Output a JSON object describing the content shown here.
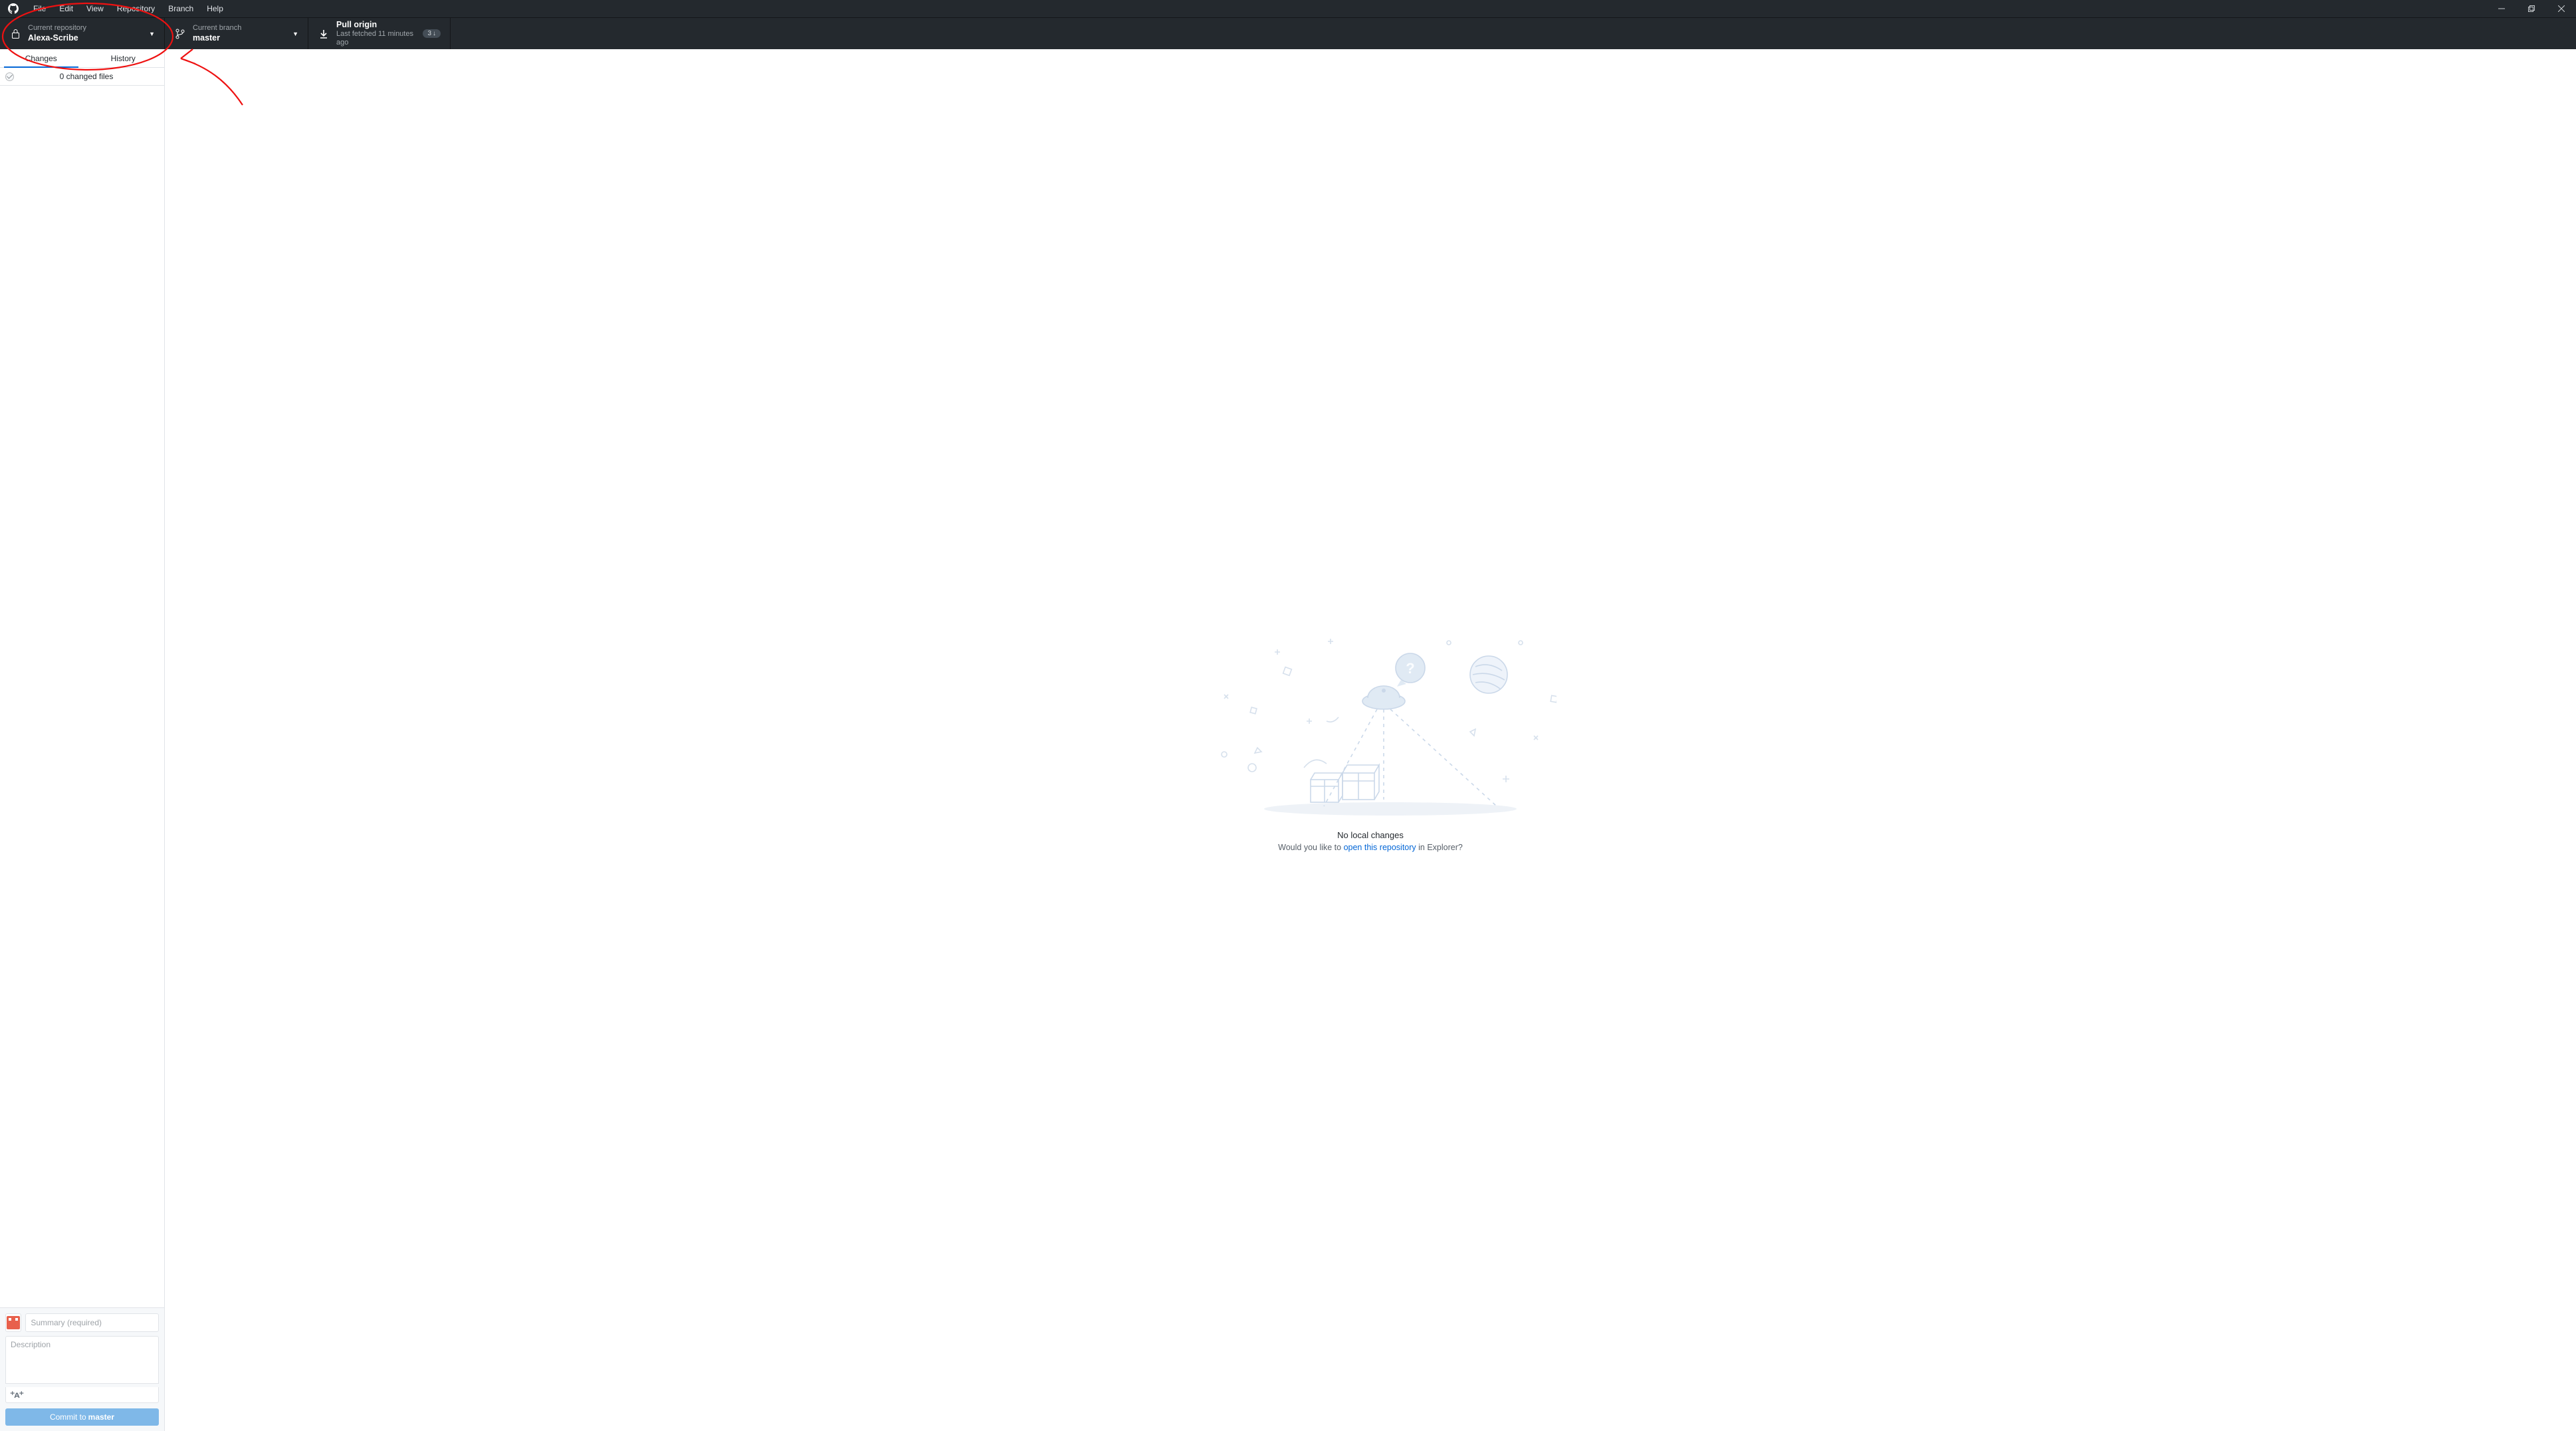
{
  "menubar": {
    "items": [
      "File",
      "Edit",
      "View",
      "Repository",
      "Branch",
      "Help"
    ]
  },
  "toolbar": {
    "repo": {
      "label": "Current repository",
      "value": "Alexa-Scribe"
    },
    "branch": {
      "label": "Current branch",
      "value": "master"
    },
    "pull": {
      "title": "Pull origin",
      "sub": "Last fetched 11 minutes ago",
      "badge_count": "3"
    }
  },
  "sidebar": {
    "tabs": {
      "changes": "Changes",
      "history": "History"
    },
    "changed_files": "0 changed files"
  },
  "commit": {
    "summary_placeholder": "Summary (required)",
    "description_placeholder": "Description",
    "button_prefix": "Commit to ",
    "button_branch": "master"
  },
  "empty": {
    "title": "No local changes",
    "prompt_pre": "Would you like to ",
    "prompt_link": "open this repository",
    "prompt_post": " in Explorer?"
  }
}
